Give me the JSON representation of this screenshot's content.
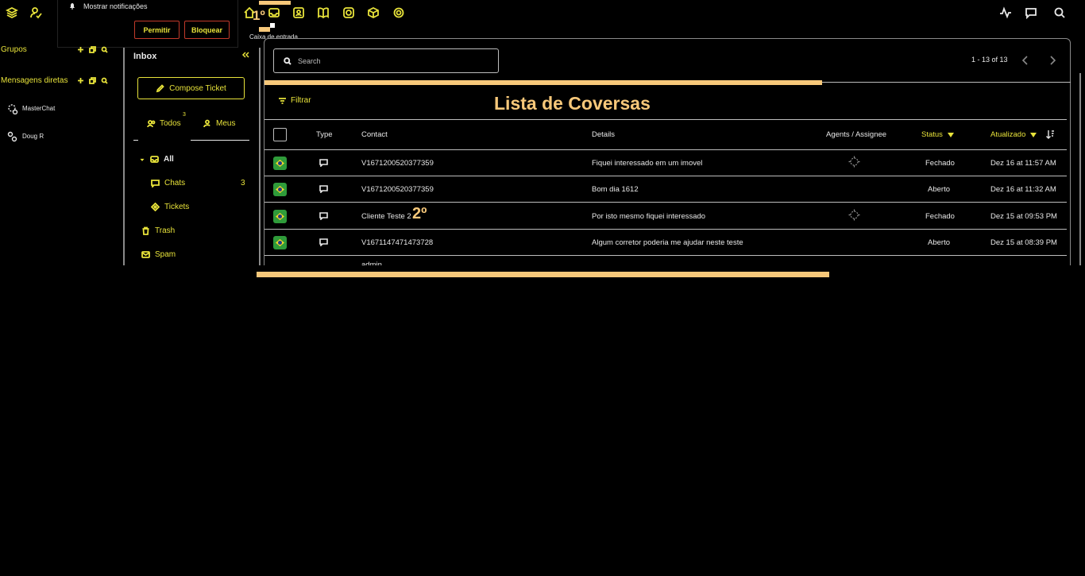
{
  "notification": {
    "title": "Mostrar notificações",
    "allow_label": "Permitir",
    "block_label": "Bloquear"
  },
  "top_nav": {
    "icons": [
      "layers-icon",
      "user-status-icon",
      "home-icon",
      "inbox-icon",
      "contacts-icon",
      "book-icon",
      "whatsapp-icon",
      "cube-icon",
      "settings-icon"
    ],
    "right_icons": [
      "activity-icon",
      "chat-icon",
      "search-icon"
    ],
    "active_tooltip": "Caixa de entrada",
    "marker_first": "1º"
  },
  "sidebar": {
    "groups_label": "Grupos",
    "direct_label": "Mensagens diretas",
    "direct_messages": [
      {
        "name": "MasterChat"
      },
      {
        "name": "Doug R"
      }
    ]
  },
  "inbox_nav": {
    "title": "Inbox",
    "compose_label": "Compose Ticket",
    "segments": [
      {
        "label": "Todos",
        "badge": "3"
      },
      {
        "label": "Meus"
      }
    ],
    "folders": [
      {
        "label": "All"
      },
      {
        "label": "Chats",
        "count": "3"
      },
      {
        "label": "Tickets"
      },
      {
        "label": "Trash"
      },
      {
        "label": "Spam"
      }
    ]
  },
  "main": {
    "search_placeholder": "Search",
    "pagination": "1 - 13 of 13",
    "filter_label": "Filtrar",
    "overlay_title": "Lista de Coversas",
    "marker_second": "2º",
    "columns": {
      "type": "Type",
      "contact": "Contact",
      "details": "Details",
      "agents": "Agents / Assignee",
      "status": "Status",
      "updated": "Atualizado"
    },
    "rows": [
      {
        "contact": "V1671200520377359",
        "details": "Fiquei interessado em um imovel",
        "has_agent": true,
        "status": "Fechado",
        "updated": "Dez 16 at 11:57 AM"
      },
      {
        "contact": "V1671200520377359",
        "details": "Bom dia 1612",
        "has_agent": false,
        "status": "Aberto",
        "updated": "Dez 16 at 11:32 AM"
      },
      {
        "contact": "Cliente Teste 2",
        "details": "Por isto mesmo fiquei interessado",
        "has_agent": true,
        "status": "Fechado",
        "updated": "Dez 15 at 09:53 PM"
      },
      {
        "contact": "V1671147471473728",
        "details": "Algum corretor poderia me ajudar neste teste",
        "has_agent": false,
        "status": "Aberto",
        "updated": "Dez 15 at 08:39 PM"
      }
    ],
    "partial_row_contact": "admin"
  },
  "colors": {
    "accent": "#e8e33a",
    "highlight": "#f7c87a",
    "background": "#000000",
    "border": "#8a8a8a"
  }
}
